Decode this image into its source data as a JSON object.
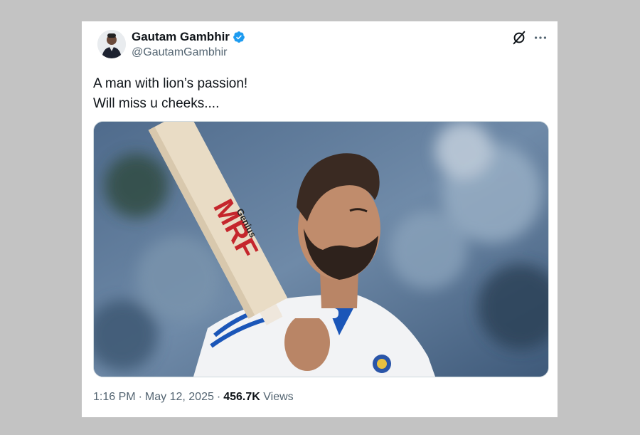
{
  "author": {
    "name": "Gautam Gambhir",
    "handle": "@GautamGambhir",
    "verified": true,
    "avatar": "avatar-photo"
  },
  "actions": {
    "grok_icon": "grok-icon",
    "more_icon": "more-horizontal-icon"
  },
  "tweet": {
    "text_lines": [
      "A man with lion’s passion!",
      "Will miss u cheeks...."
    ]
  },
  "media": {
    "image": "photo-cricketer-raising-bat",
    "bat_brand": "MRF",
    "bat_label": "Genius"
  },
  "meta": {
    "time": "1:16 PM",
    "date": "May 12, 2025",
    "views_count": "456.7K",
    "views_label": "Views",
    "separator": "·"
  },
  "colors": {
    "text_primary": "#0f1419",
    "text_secondary": "#536471",
    "verified_blue": "#1d9bf0",
    "page_bg": "#c3c3c3",
    "card_bg": "#ffffff"
  }
}
